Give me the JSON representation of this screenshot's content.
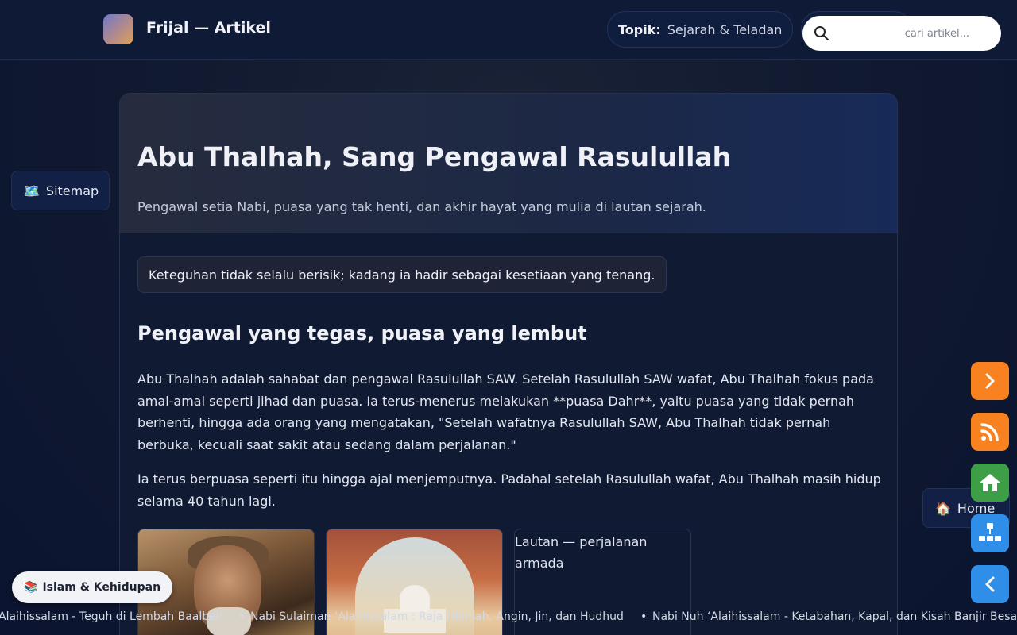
{
  "header": {
    "brand": "Frijal — Artikel",
    "topic_key": "Topik:",
    "topic_value": "Sejarah & Teladan",
    "search_placeholder": "cari artikel..."
  },
  "sidebar": {
    "sitemap_icon": "🗺️",
    "sitemap_label": "Sitemap"
  },
  "article": {
    "title": "Abu Thalhah, Sang Pengawal Rasulullah",
    "subtitle": "Pengawal setia Nabi, puasa yang tak henti, dan akhir hayat yang mulia di lautan sejarah.",
    "quote": "Keteguhan tidak selalu berisik; kadang ia hadir sebagai kesetiaan yang tenang.",
    "section_heading": "Pengawal yang tegas, puasa yang lembut",
    "paragraph_1": "Abu Thalhah adalah sahabat dan pengawal Rasulullah SAW. Setelah Rasulullah SAW wafat, Abu Thalhah fokus pada amal-amal seperti jihad dan puasa. Ia terus-menerus melakukan **puasa Dahr**, yaitu puasa yang tidak pernah berhenti, hingga ada orang yang mengatakan, \"Setelah wafatnya Rasulullah SAW, Abu Thalhah tidak pernah berbuka, kecuali saat sakit atau sedang dalam perjalanan.\"",
    "paragraph_2": "Ia terus berpuasa seperti itu hingga ajal menjemputnya. Padahal setelah Rasulullah wafat, Abu Thalhah masih hidup selama 40 tahun lagi.",
    "image_3_alt": "Lautan — perjalanan armada"
  },
  "category_chip": {
    "icon": "📚",
    "label": "Islam & Kehidupan"
  },
  "ticker": {
    "items": [
      "Alaihissalam - Teguh di Lembah Baalbek",
      "Nabi Sulaiman ‘Alaihissalam : Raja Hikmah, Angin, Jin, dan Hudhud",
      "Nabi Nuh ‘Alaihissalam - Ketabahan, Kapal, dan Kisah Banjir Besar"
    ]
  },
  "floating": {
    "home_icon": "🏠",
    "home_label": "Home"
  },
  "colors": {
    "orange": "#f7821f",
    "green": "#3e9e47",
    "blue": "#2f8ee8"
  },
  "icons": [
    "search-icon",
    "map-icon",
    "chevron-right-icon",
    "rss-icon",
    "home-icon",
    "sitemap-icon",
    "chevron-left-icon",
    "books-icon"
  ]
}
